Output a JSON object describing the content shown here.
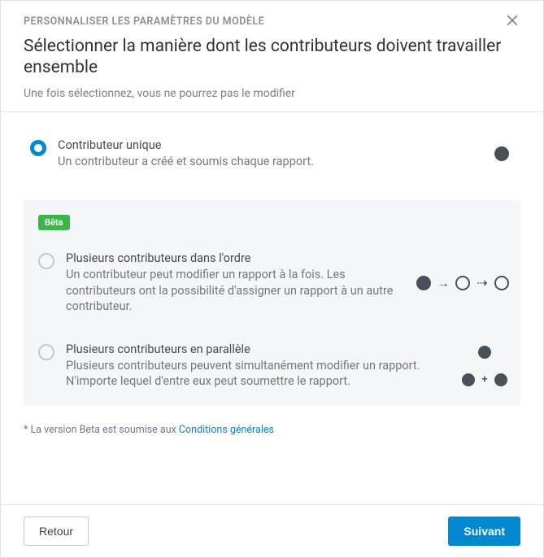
{
  "header": {
    "eyebrow": "PERSONNALISER LES PARAMÈTRES DU MODÈLE",
    "title": "Sélectionner la manière dont les contributeurs doivent travailler ensemble",
    "subtitle": "Une fois sélectionnez, vous ne pourrez pas le modifier"
  },
  "beta_badge": "Bêta",
  "options": {
    "single": {
      "title": "Contributeur unique",
      "desc": "Un contributeur a créé et soumis chaque rapport."
    },
    "sequential": {
      "title": "Plusieurs contributeurs dans l'ordre",
      "desc": "Un contributeur peut modifier un rapport à la fois. Les contributeurs ont la possibilité d'assigner un rapport à un autre contributeur."
    },
    "parallel": {
      "title": "Plusieurs contributeurs en parallèle",
      "desc": "Plusieurs contributeurs peuvent simultanément modifier un rapport. N'importe lequel d'entre eux peut soumettre le rapport."
    }
  },
  "beta_note_prefix": "* La version Beta est soumise aux ",
  "beta_note_link": "Conditions générales",
  "footer": {
    "back": "Retour",
    "next": "Suivant"
  }
}
